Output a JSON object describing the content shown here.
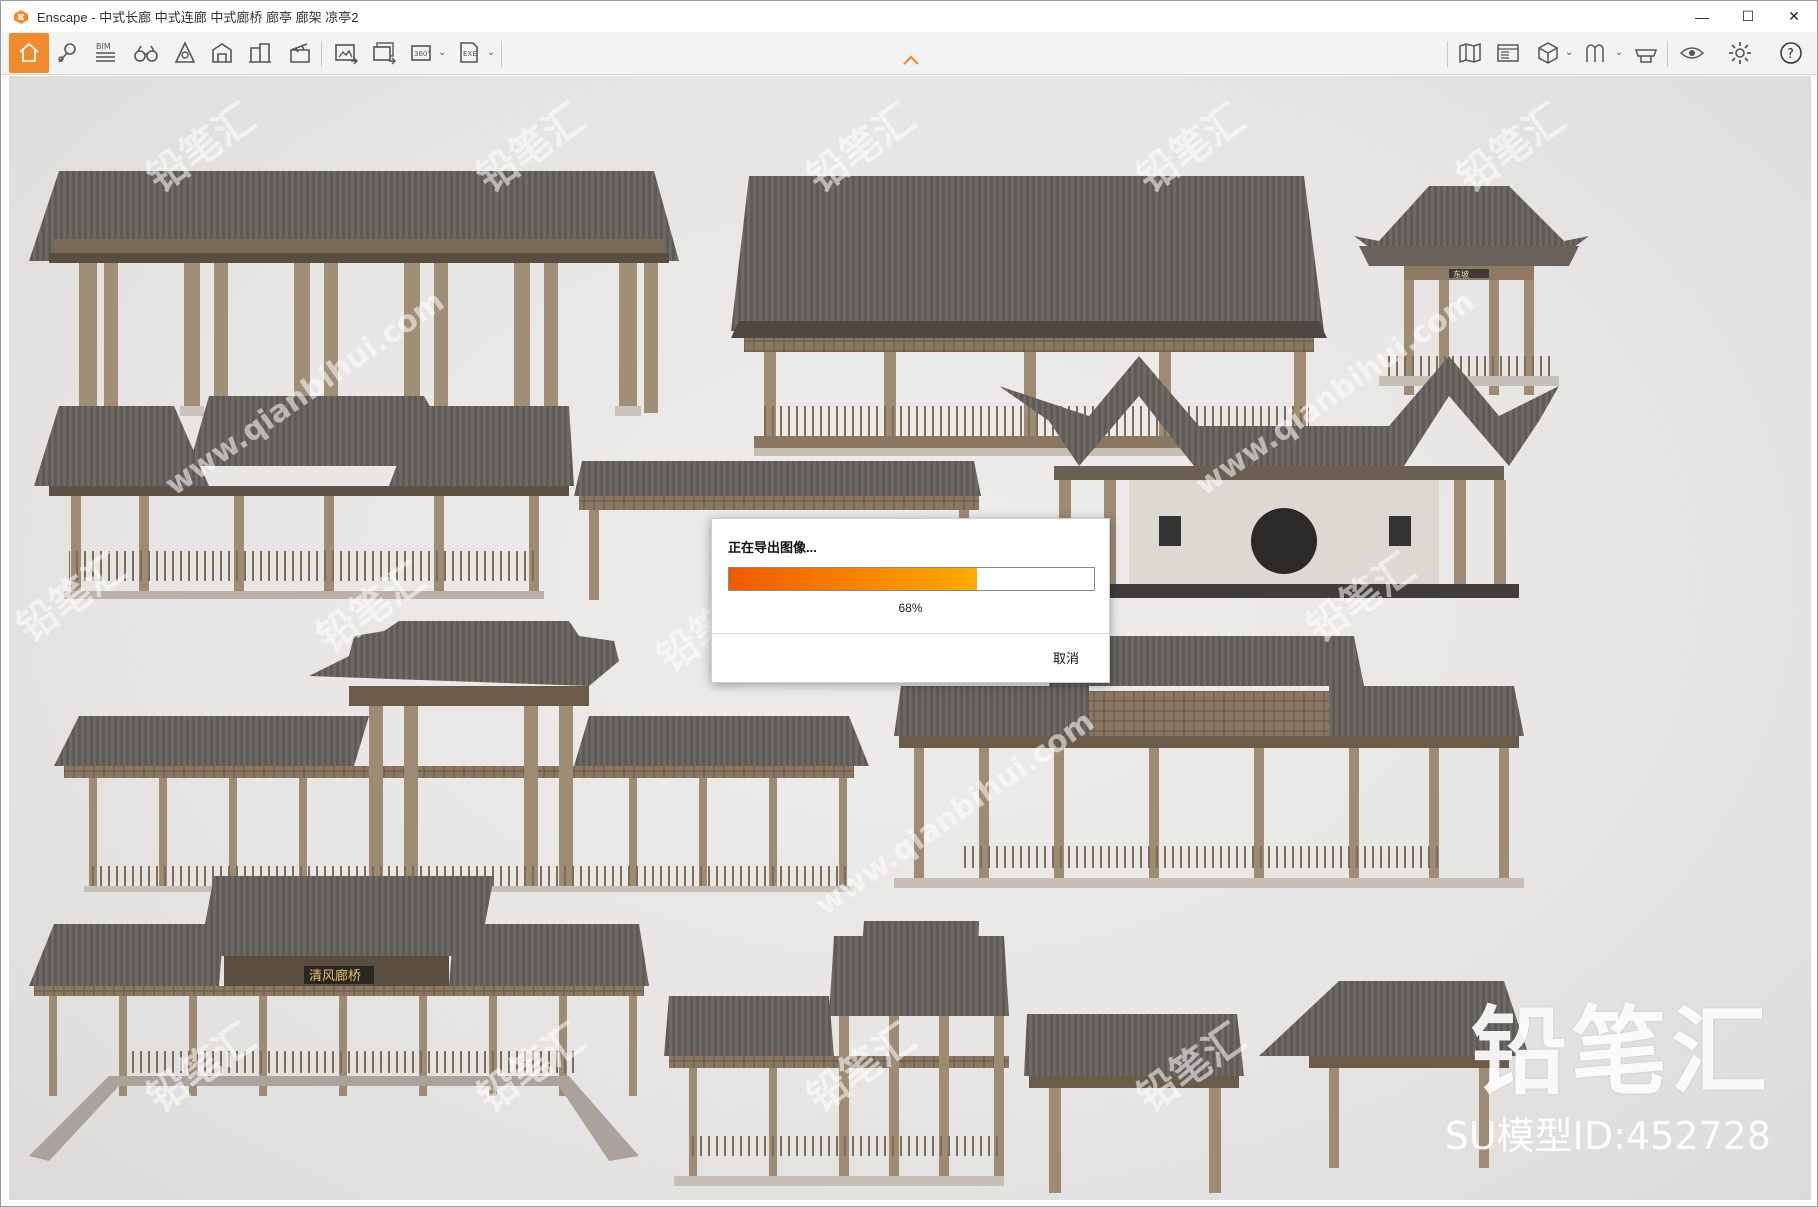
{
  "window": {
    "title": "Enscape - 中式长廊 中式连廊 中式廊桥 廊亭 廊架 凉亭2",
    "controls": {
      "minimize": "—",
      "maximize": "☐",
      "close": "✕"
    }
  },
  "toolbar": {
    "left_icons": [
      "home-icon",
      "map-pin-icon",
      "bim-icon",
      "binoculars-icon",
      "bell-icon",
      "asset-icon",
      "building-icon",
      "clapperboard-icon",
      "screenshot-icon",
      "batch-render-icon",
      "panorama-360-icon",
      "exe-export-icon"
    ],
    "right_icons": [
      "map-icon",
      "window-icon",
      "cube-icon",
      "texture-icon",
      "hat-icon",
      "eye-icon",
      "settings-icon",
      "help-icon"
    ],
    "bim_label": "BIM",
    "pano_label": "360°",
    "exe_label": "EXE",
    "help_label": "?",
    "accent": "#f08b2d"
  },
  "dialog": {
    "title": "正在导出图像...",
    "progress": 0.68,
    "progress_text": "68%",
    "cancel_label": "取消"
  },
  "watermarks": {
    "repeat": "铅笔汇",
    "url": "www.qianbihui.com",
    "brand": "铅笔汇",
    "id_label": "SU模型ID:452728"
  },
  "signs": {
    "bridge_sign": "清风廊桥",
    "pavilion_sign": "东坡"
  }
}
